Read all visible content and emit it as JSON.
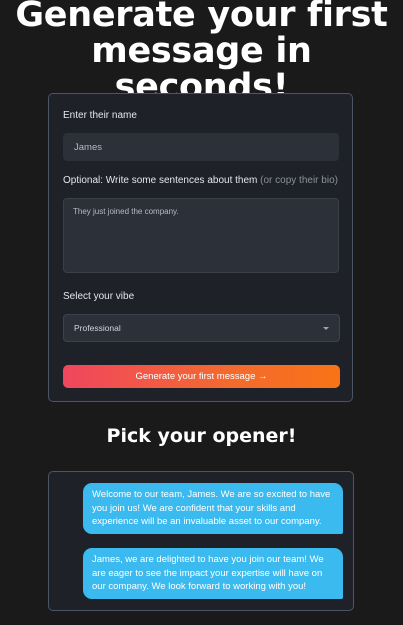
{
  "hero": {
    "title": "Generate your first message in seconds!"
  },
  "form": {
    "name_label": "Enter their name",
    "name_value": "James",
    "bio_label": "Optional: Write some sentences about them",
    "bio_hint": "(or copy their bio)",
    "bio_value": "They just joined the company.",
    "vibe_label": "Select your vibe",
    "vibe_value": "Professional",
    "generate_label": "Generate your first message →"
  },
  "openers": {
    "title": "Pick your opener!",
    "messages": [
      "Welcome to our team, James. We are so excited to have you join us! We are confident that your skills and experience will be an invaluable asset to our company.",
      "James, we are delighted to have you join our team! We are eager to see the impact your expertise will have on our company. We look forward to working with you!"
    ]
  },
  "colors": {
    "background": "#1a1a1a",
    "card": "#1e2128",
    "button_gradient_start": "#f0465e",
    "button_gradient_end": "#f97316",
    "bubble": "#3bbaf0"
  },
  "icons": {
    "select_arrow": "chevron-down-icon"
  }
}
